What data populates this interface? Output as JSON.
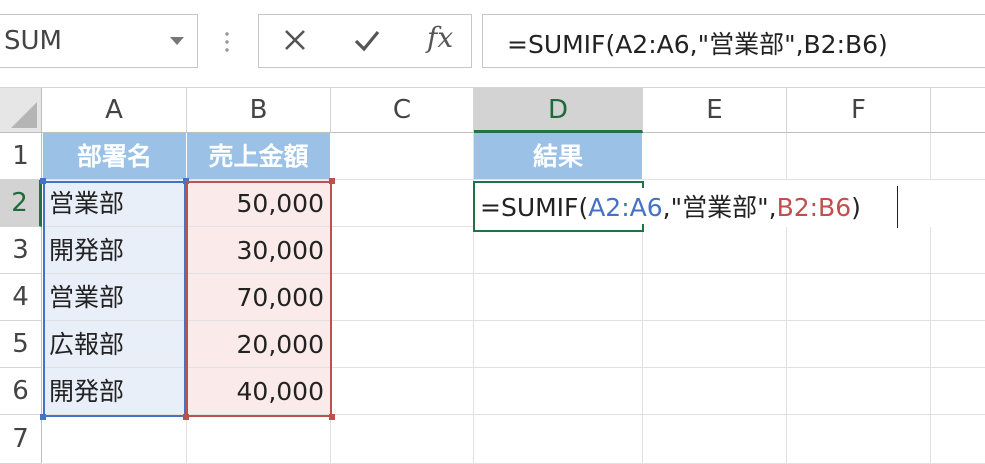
{
  "namebox": {
    "value": "SUM"
  },
  "formula_bar": {
    "cancel_icon": "x-icon",
    "enter_icon": "check-icon",
    "fx_label": "fx",
    "formula": "=SUMIF(A2:A6,\"営業部\",B2:B6)"
  },
  "columns": [
    "A",
    "B",
    "C",
    "D",
    "E",
    "F"
  ],
  "rows": [
    "1",
    "2",
    "3",
    "4",
    "5",
    "6",
    "7"
  ],
  "active": {
    "column": "D",
    "row": "2"
  },
  "table": {
    "headers": [
      "部署名",
      "売上金額"
    ],
    "data": [
      [
        "営業部",
        "50,000"
      ],
      [
        "開発部",
        "30,000"
      ],
      [
        "営業部",
        "70,000"
      ],
      [
        "広報部",
        "20,000"
      ],
      [
        "開発部",
        "40,000"
      ]
    ]
  },
  "result_header": "結果",
  "edit": {
    "prefix": "=SUMIF(",
    "range1": "A2:A6",
    "middle": ",\"営業部\",",
    "range2": "B2:B6",
    "suffix": ")"
  },
  "colors": {
    "header_fill": "#9bc2e6",
    "range1_color": "#4472c4",
    "range2_color": "#c0504d",
    "active_border": "#217346"
  }
}
